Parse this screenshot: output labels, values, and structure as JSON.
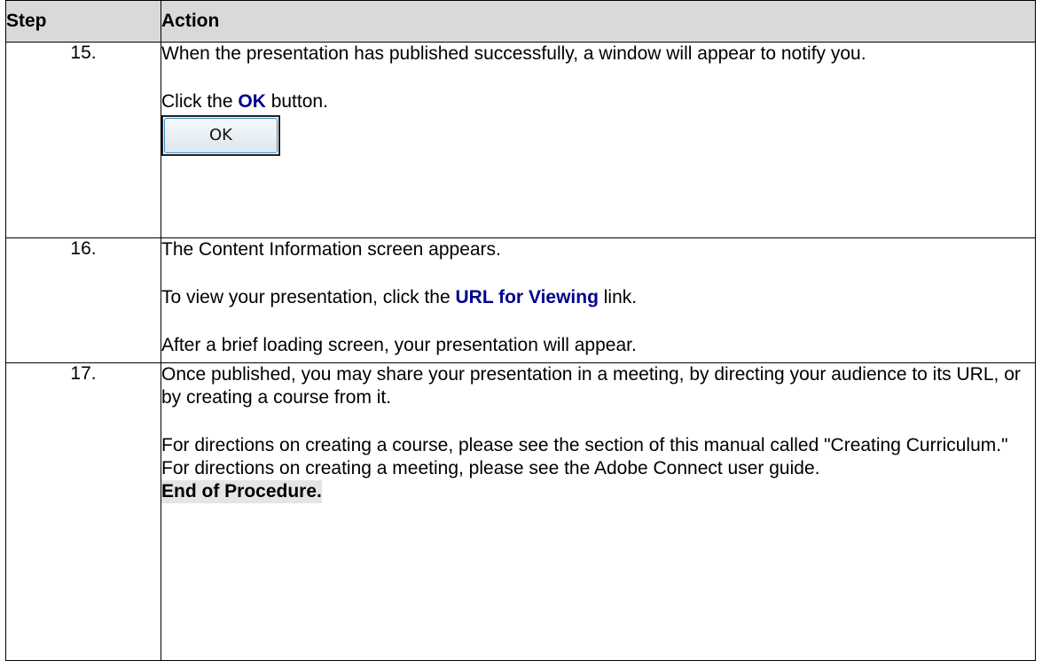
{
  "table": {
    "headers": {
      "step": "Step",
      "action": "Action"
    },
    "rows": [
      {
        "step": "15.",
        "line1": "When the presentation has published successfully, a window will appear to notify you.",
        "click_prefix": "Click the ",
        "click_target": "OK",
        "click_suffix": " button.",
        "button_label": "OK"
      },
      {
        "step": "16.",
        "line1": "The Content Information screen appears.",
        "view_prefix": "To view your presentation, click the ",
        "view_target": "URL for Viewing",
        "view_suffix": " link.",
        "line3": "After a brief loading screen, your presentation will appear."
      },
      {
        "step": "17.",
        "line1": "Once published, you may share your presentation in a meeting, by directing your audience to its URL, or by creating a course from it.",
        "line2": "For directions on creating a course, please see the section of this manual called \"Creating Curriculum.\"  For directions on creating a meeting, please see the Adobe Connect user guide.",
        "end_label": "End of Procedure."
      }
    ]
  }
}
